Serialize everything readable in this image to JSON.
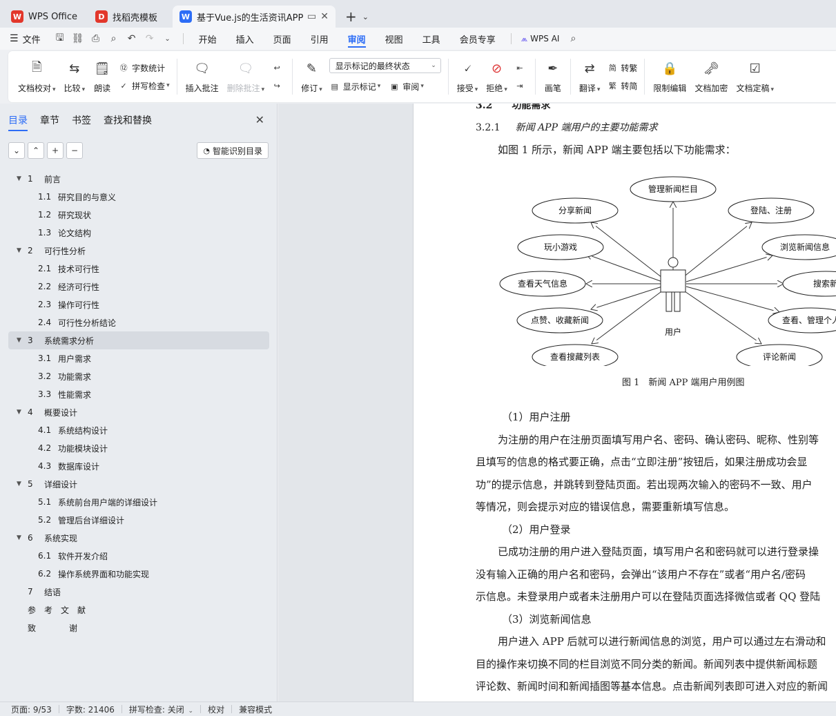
{
  "tabs": [
    {
      "label": "WPS Office",
      "icon": "wps-logo-icon",
      "color": "#e2372b",
      "glyph": "W"
    },
    {
      "label": "找稻壳模板",
      "icon": "docer-logo-icon",
      "color": "#e2372b",
      "glyph": "D"
    },
    {
      "label": "基于Vue.js的生活资讯APP的设",
      "icon": "word-doc-icon",
      "color": "#2d6df6",
      "glyph": "W",
      "active": true
    }
  ],
  "menubar": {
    "file_label": "文件",
    "items": [
      "开始",
      "插入",
      "页面",
      "引用",
      "审阅",
      "视图",
      "工具",
      "会员专享"
    ],
    "active_index": 4,
    "ai_label": "WPS AI"
  },
  "ribbon": {
    "doc_check": "文档校对",
    "compare": "比较",
    "read_aloud": "朗读",
    "word_count": "字数统计",
    "spell_check": "拼写检查",
    "insert_comment": "插入批注",
    "delete_comment": "删除批注",
    "revise": "修订",
    "markup_state": "显示标记的最终状态",
    "show_markup": "显示标记",
    "review": "审阅",
    "accept": "接受",
    "reject": "拒绝",
    "pen": "画笔",
    "translate": "翻译",
    "to_traditional": "转繁",
    "to_simplified": "转简",
    "restrict_edit": "限制编辑",
    "encrypt": "文档加密",
    "finalize": "文档定稿"
  },
  "nav": {
    "tabs": [
      "目录",
      "章节",
      "书签",
      "查找和替换"
    ],
    "smart_toc": "智能识别目录",
    "toc": [
      {
        "num": "1",
        "label": "前言",
        "level": 1
      },
      {
        "num": "1.1",
        "label": "研究目的与意义",
        "level": 2
      },
      {
        "num": "1.2",
        "label": "研究现状",
        "level": 2
      },
      {
        "num": "1.3",
        "label": "论文结构",
        "level": 2
      },
      {
        "num": "2",
        "label": "可行性分析",
        "level": 1
      },
      {
        "num": "2.1",
        "label": "技术可行性",
        "level": 2
      },
      {
        "num": "2.2",
        "label": "经济可行性",
        "level": 2
      },
      {
        "num": "2.3",
        "label": "操作可行性",
        "level": 2
      },
      {
        "num": "2.4",
        "label": "可行性分析结论",
        "level": 2
      },
      {
        "num": "3",
        "label": "系统需求分析",
        "level": 1,
        "selected": true
      },
      {
        "num": "3.1",
        "label": "用户需求",
        "level": 2
      },
      {
        "num": "3.2",
        "label": "功能需求",
        "level": 2
      },
      {
        "num": "3.3",
        "label": "性能需求",
        "level": 2
      },
      {
        "num": "4",
        "label": "概要设计",
        "level": 1
      },
      {
        "num": "4.1",
        "label": "系统结构设计",
        "level": 2
      },
      {
        "num": "4.2",
        "label": "功能模块设计",
        "level": 2
      },
      {
        "num": "4.3",
        "label": "数据库设计",
        "level": 2
      },
      {
        "num": "5",
        "label": "详细设计",
        "level": 1
      },
      {
        "num": "5.1",
        "label": "系统前台用户端的详细设计",
        "level": 2
      },
      {
        "num": "5.2",
        "label": "管理后台详细设计",
        "level": 2
      },
      {
        "num": "6",
        "label": "系统实现",
        "level": 1
      },
      {
        "num": "6.1",
        "label": "软件开发介绍",
        "level": 2
      },
      {
        "num": "6.2",
        "label": "操作系统界面和功能实现",
        "level": 2
      },
      {
        "num": "7",
        "label": "结语",
        "level": 1,
        "noarrow": true
      },
      {
        "num": "",
        "label": "参　考　文　献",
        "level": 0
      },
      {
        "num": "",
        "label": "致　　　　谢",
        "level": 0
      }
    ]
  },
  "doc": {
    "heading_cut": "3.2　　功能需求",
    "h321_num": "3.2.1",
    "h321_text": "新闻 APP 端用户的主要功能需求",
    "intro": "如图 1 所示，新闻 APP 端主要包括以下功能需求：",
    "diagram": {
      "actor": "用户",
      "usecases": [
        "管理新闻栏目",
        "分享新闻",
        "登陆、注册",
        "玩小游戏",
        "浏览新闻信息",
        "查看天气信息",
        "搜索新",
        "点赞、收藏新闻",
        "查看、管理个人",
        "查看搜藏列表",
        "评论新闻"
      ]
    },
    "caption": "图 1　新闻 APP 端用户用例图",
    "lines": [
      {
        "text": "（1）用户注册",
        "style": "sub"
      },
      {
        "text": "为注册的用户在注册页面填写用户名、密码、确认密码、昵称、性别等",
        "style": "ind"
      },
      {
        "text": "且填写的信息的格式要正确，点击“立即注册”按钮后，如果注册成功会显",
        "style": ""
      },
      {
        "text": "功”的提示信息，并跳转到登陆页面。若出现两次输入的密码不一致、用户",
        "style": ""
      },
      {
        "text": "等情况，则会提示对应的错误信息，需要重新填写信息。",
        "style": ""
      },
      {
        "text": "（2）用户登录",
        "style": "sub"
      },
      {
        "text": "已成功注册的用户进入登陆页面，填写用户名和密码就可以进行登录操",
        "style": "ind"
      },
      {
        "text": "没有输入正确的用户名和密码，会弹出“该用户不存在”或者“用户名/密码",
        "style": ""
      },
      {
        "text": "示信息。未登录用户或者未注册用户可以在登陆页面选择微信或者 QQ 登陆",
        "style": ""
      },
      {
        "text": "（3）浏览新闻信息",
        "style": "sub"
      },
      {
        "text": "用户进入 APP 后就可以进行新闻信息的浏览，用户可以通过左右滑动和",
        "style": "ind"
      },
      {
        "text": "目的操作来切换不同的栏目浏览不同分类的新闻。新闻列表中提供新闻标题",
        "style": ""
      },
      {
        "text": "评论数、新闻时间和新闻插图等基本信息。点击新闻列表即可进入对应的新闻",
        "style": ""
      }
    ]
  },
  "status": {
    "page": "页面: 9/53",
    "words": "字数: 21406",
    "spell": "拼写检查: 关闭",
    "proof": "校对",
    "compat": "兼容模式"
  }
}
